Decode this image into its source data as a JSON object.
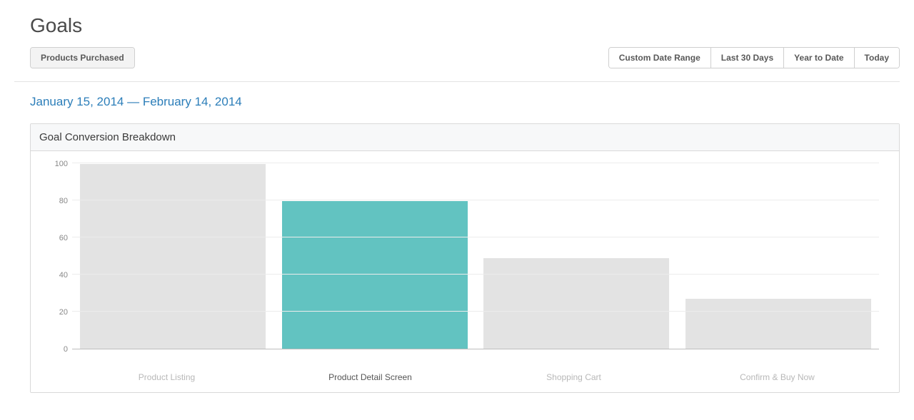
{
  "header": {
    "title": "Goals"
  },
  "filters": {
    "goal_selector": {
      "label": "Products Purchased"
    },
    "date_ranges": [
      {
        "label": "Custom Date Range"
      },
      {
        "label": "Last 30 Days"
      },
      {
        "label": "Year to Date"
      },
      {
        "label": "Today"
      }
    ]
  },
  "date_range_display": "January 15, 2014 — February 14, 2014",
  "panel": {
    "title": "Goal Conversion Breakdown"
  },
  "chart_data": {
    "type": "bar",
    "title": "Goal Conversion Breakdown",
    "xlabel": "",
    "ylabel": "",
    "ylim": [
      0,
      100
    ],
    "y_ticks": [
      0,
      20,
      40,
      60,
      80,
      100
    ],
    "categories": [
      "Product Listing",
      "Product Detail Screen",
      "Shopping Cart",
      "Confirm & Buy Now"
    ],
    "values": [
      100,
      80,
      49,
      27
    ],
    "highlighted_index": 1,
    "colors": {
      "default": "#e3e3e3",
      "highlight": "#62c3c1"
    }
  }
}
